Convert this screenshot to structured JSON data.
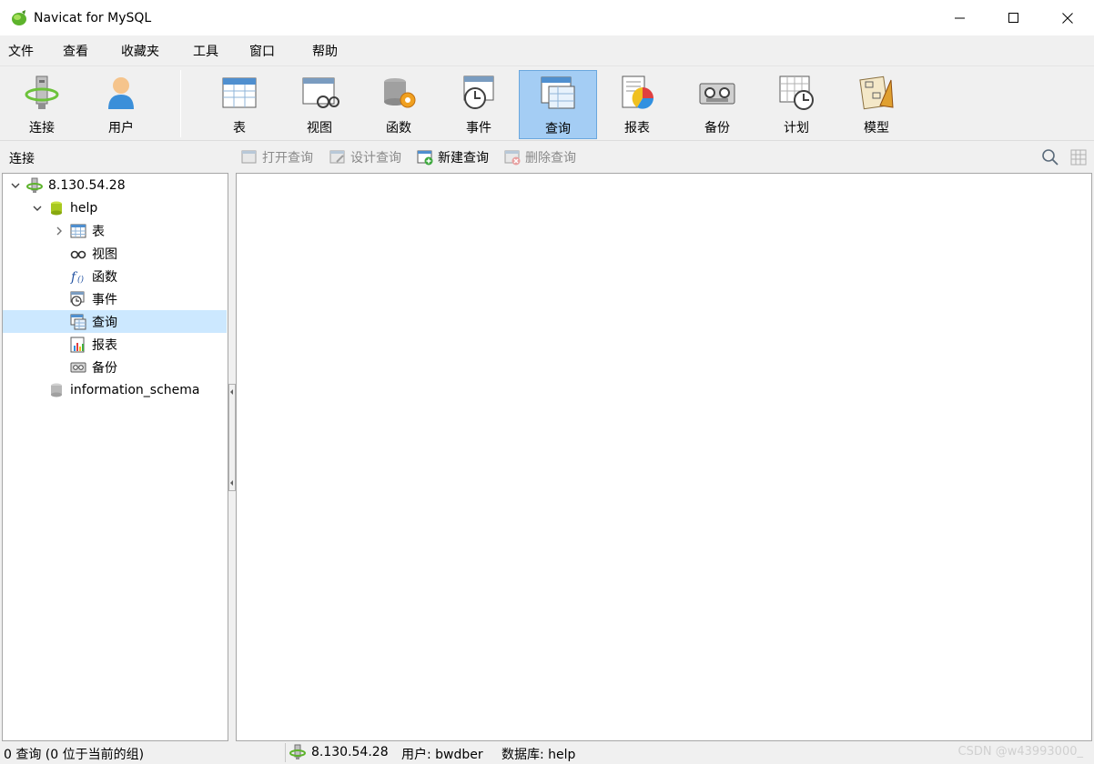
{
  "window": {
    "title": "Navicat for MySQL"
  },
  "menu": [
    "文件",
    "查看",
    "收藏夹",
    "工具",
    "窗口",
    "帮助"
  ],
  "toolbar": {
    "connect": "连接",
    "user": "用户",
    "table": "表",
    "view": "视图",
    "function": "函数",
    "event": "事件",
    "query": "查询",
    "report": "报表",
    "backup": "备份",
    "schedule": "计划",
    "model": "模型",
    "active": "查询"
  },
  "subbar": {
    "title": "连接",
    "open_query": "打开查询",
    "design_query": "设计查询",
    "new_query": "新建查询",
    "delete_query": "删除查询"
  },
  "tree": {
    "connection": "8.130.54.28",
    "database": "help",
    "children": [
      "表",
      "视图",
      "函数",
      "事件",
      "查询",
      "报表",
      "备份"
    ],
    "selected": "查询",
    "other_db": "information_schema"
  },
  "status": {
    "count": "0 查询 (0 位于当前的组)",
    "connection": "8.130.54.28",
    "user": "用户: bwdber",
    "database": "数据库: help",
    "watermark": "CSDN @w43993000_"
  },
  "colors": {
    "selection": "#cce8ff",
    "active_tool": "#a4cdf4",
    "pane_border": "#a6a6a6"
  },
  "icons": [
    "navicat-logo-icon",
    "minimize-icon",
    "maximize-icon",
    "close-icon",
    "search-icon",
    "grid-view-icon"
  ]
}
